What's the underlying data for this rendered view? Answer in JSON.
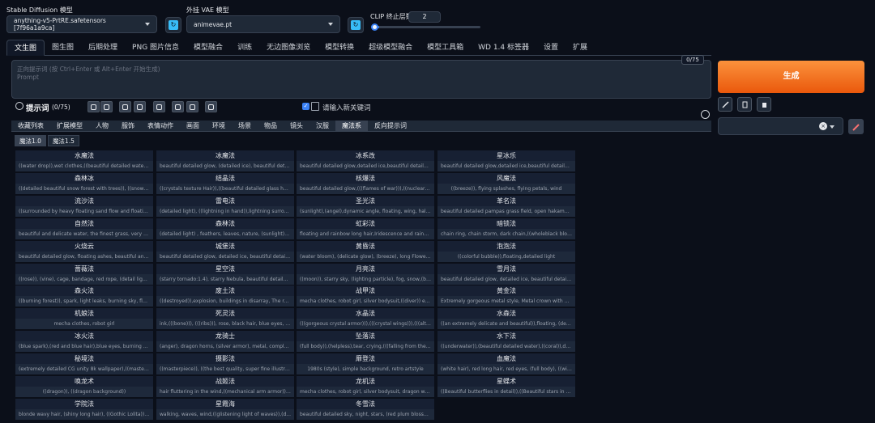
{
  "header": {
    "model_label": "Stable Diffusion 模型",
    "model_value": "anything-v5-PrtRE.safetensors [7f96a1a9ca]",
    "vae_label": "外挂 VAE 模型",
    "vae_value": "animevae.pt",
    "clip_label": "CLIP 终止层数",
    "clip_value": "2",
    "clip_min": 1,
    "clip_max": 12
  },
  "tabs": [
    "文生图",
    "图生图",
    "后期处理",
    "PNG 图片信息",
    "模型融合",
    "训练",
    "无边图像浏览",
    "模型转换",
    "超级模型融合",
    "模型工具箱",
    "WD 1.4 标签器",
    "设置",
    "扩展"
  ],
  "prompt": {
    "placeholder": "正向提示词 (按 Ctrl+Enter 或 Alt+Enter 开始生成)",
    "placeholder2": "Prompt",
    "token_count": "0/75"
  },
  "generate_label": "生成",
  "prompt_helper": {
    "title": "提示词",
    "count": "(0/75)",
    "checkbox_label": "请输入新关键词"
  },
  "categories": [
    "收藏列表",
    "扩展模型",
    "人物",
    "服饰",
    "表情动作",
    "画面",
    "环境",
    "场景",
    "物品",
    "镜头",
    "汉服",
    "魔法系",
    "反向提示词"
  ],
  "subtabs": [
    "魔法1.0",
    "魔法1.5"
  ],
  "cards": [
    {
      "t": "水魔法",
      "d": "((water drop)),wet clothes,((beautiful detailed water))..."
    },
    {
      "t": "冰魔法",
      "d": "beautiful detailed glow, (detailed ice), beautiful detail..."
    },
    {
      "t": "冰系改",
      "d": "beautiful detailed glow,detailed ice,beautiful detaile..."
    },
    {
      "t": "星冰乐",
      "d": "beautiful detailed glow,detailed ice,beautiful detailed..."
    },
    {
      "t": "森林冰",
      "d": "((detailed beautiful snow forest with trees)), ((snowfla..."
    },
    {
      "t": "结晶法",
      "d": "((crystals texture Hair)),((beautiful detailed glass hai..."
    },
    {
      "t": "核爆法",
      "d": "beautiful detailed glow,(((flames of war))),((nuclear ex..."
    },
    {
      "t": "风魔法",
      "d": "((breeze)), flying splashes, flying petals, wind"
    },
    {
      "t": "流沙法",
      "d": "((surrounded by heavy floating sand flow and floating..."
    },
    {
      "t": "雷电法",
      "d": "(detailed light), ((lightning in hand)),lightning surroun..."
    },
    {
      "t": "圣光法",
      "d": "(sunlight),(angel),dynamic angle, floating, wing, halo, ..."
    },
    {
      "t": "革名法",
      "d": "beautiful detailed pampas grass field, open hakama, s..."
    },
    {
      "t": "自然法",
      "d": "beautiful and delicate water, the finest grass, very deli..."
    },
    {
      "t": "森林法",
      "d": "(detailed light) , feathers, leaves, nature, (sunlight), riv..."
    },
    {
      "t": "虹彩法",
      "d": "floating and rainbow long hair,Iridescence and rainbo..."
    },
    {
      "t": "暗锁法",
      "d": "chain ring, chain storm, dark chain,((wholeblack bloo..."
    },
    {
      "t": "火烧云",
      "d": "beautiful detailed glow, floating ashes, beautiful and ..."
    },
    {
      "t": "城堡法",
      "d": "beautiful detailed glow, detailed ice, beautiful detaile..."
    },
    {
      "t": "黄昏法",
      "d": "(water bloom), (delicate glow), (breeze), long Flowers ..."
    },
    {
      "t": "泡泡法",
      "d": "((colorful bubble)),floating,detailed light"
    },
    {
      "t": "蔷薇法",
      "d": "((rose)), (vine), cage, bandage, red rope, (detail light), ..."
    },
    {
      "t": "星空法",
      "d": "(starry tornado:1.4), starry Nebula, beautiful detailed ..."
    },
    {
      "t": "月亮法",
      "d": "((moon)), starry sky, (lighting particle), fog, snow,(bio..."
    },
    {
      "t": "雪月法",
      "d": "beautiful detailed glow, detailed ice, beautiful detaile..."
    },
    {
      "t": "森火法",
      "d": "((burning forest)), spark, light leaks, burning sky, flam..."
    },
    {
      "t": "废土法",
      "d": "((destroyed)),explosion, buildings in disarray, The resi..."
    },
    {
      "t": "战甲法",
      "d": "mecha clothes, robot girl, silver bodysuit,((diver)) en..."
    },
    {
      "t": "黄金法",
      "d": "Extremely gorgeous metal style, Metal crown with orn..."
    },
    {
      "t": "机娘法",
      "d": "mecha clothes, robot girl"
    },
    {
      "t": "死灵法",
      "d": "ink,(((bone))), (((ribs))), rose, black hair, blue eyes, gre..."
    },
    {
      "t": "水晶法",
      "d": "(((gorgeous crystal armor))),(((crystal wings))),(((altoco..."
    },
    {
      "t": "水森法",
      "d": "((an extremely delicate and beautiful)),floating, (detai..."
    },
    {
      "t": "冰火法",
      "d": "(blue spark),(red and blue hair),blue eyes, burning sky..."
    },
    {
      "t": "龙骑士",
      "d": "(anger), dragon horns, (silver armor), metal, complex ..."
    },
    {
      "t": "坠落法",
      "d": "(full body)),(helpless),tear, crying,(((falling from the ..."
    },
    {
      "t": "水下法",
      "d": "((underwater)),(beautiful detailed water),((coral)),dyn..."
    },
    {
      "t": "秘境法",
      "d": "(extremely detailed CG unity 8k wallpaper),((masterp..."
    },
    {
      "t": "摄影法",
      "d": "((masterpiece)), ((the best quality, super fine illustra..."
    },
    {
      "t": "靡登法",
      "d": "1980s (style), simple background, retro artstyle"
    },
    {
      "t": "血魔法",
      "d": "(white hair), red long hair, red eyes, (full body), ((with..."
    },
    {
      "t": "唤龙术",
      "d": "((dragon)), ((dragon background))"
    },
    {
      "t": "战姬法",
      "d": "hair fluttering in the wind,((mechanical arm armor)),(..."
    },
    {
      "t": "龙机法",
      "d": "mecha clothes, robot girl, silver bodysuit, dragon win..."
    },
    {
      "t": "星蝶术",
      "d": "((Beautiful butterflies in detail)),((Beautiful stars in de..."
    },
    {
      "t": "学院法",
      "d": "blonde wavy hair, (shiny long hair), ((Gothic Lolita)), b..."
    },
    {
      "t": "星霞海",
      "d": "walking, waves, wind,((glistening light of waves)),(d..."
    },
    {
      "t": "冬雪法",
      "d": "beautiful detailed sky, night, stars, (red plum blossom..."
    }
  ]
}
